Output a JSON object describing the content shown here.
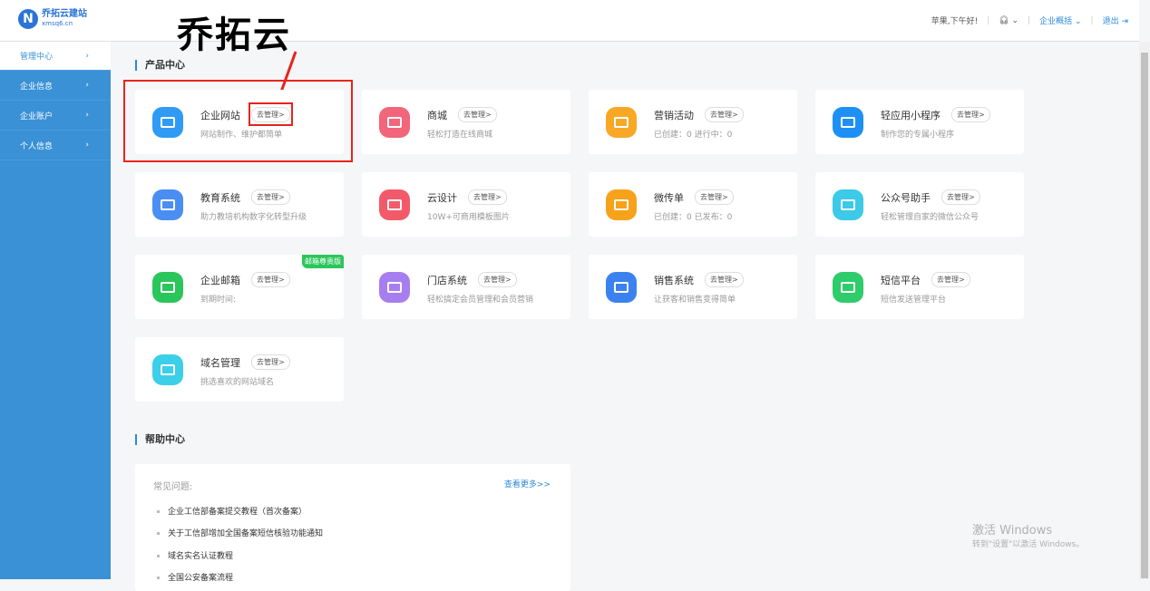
{
  "logo": {
    "name": "乔拓云建站",
    "url": "xmsq6.cn",
    "mark": "N"
  },
  "header": {
    "greeting": "苹果,下午好!",
    "enterprise": "企业概括",
    "logout": "退出"
  },
  "sidebar": {
    "items": [
      {
        "label": "管理中心"
      },
      {
        "label": "企业信息"
      },
      {
        "label": "企业账户"
      },
      {
        "label": "个人信息"
      }
    ]
  },
  "annotation": {
    "text": "乔拓云"
  },
  "products": {
    "title": "产品中心",
    "manage_label": "去管理>",
    "badge": "邮箱尊贵版",
    "cards": [
      {
        "name": "企业网站",
        "desc": "网站制作、维护都简单",
        "color": "#2f9bf5"
      },
      {
        "name": "商城",
        "desc": "轻松打造在线商城",
        "color": "#f2657a"
      },
      {
        "name": "营销活动",
        "desc": "已创建：0    进行中：0",
        "color": "#f9a825"
      },
      {
        "name": "轻应用小程序",
        "desc": "制作您的专属小程序",
        "color": "#1e90f5"
      },
      {
        "name": "教育系统",
        "desc": "助力教培机构数字化转型升级",
        "color": "#4a8ef2"
      },
      {
        "name": "云设计",
        "desc": "10W+可商用模板图片",
        "color": "#f25a6a"
      },
      {
        "name": "微传单",
        "desc": "已创建：0    已发布：0",
        "color": "#f7a21b"
      },
      {
        "name": "公众号助手",
        "desc": "轻松管理自家的微信公众号",
        "color": "#3dc9e8"
      },
      {
        "name": "企业邮箱",
        "desc": "到期时间:",
        "color": "#2bc65b"
      },
      {
        "name": "门店系统",
        "desc": "轻松搞定会员管理和会员营销",
        "color": "#a77ef0"
      },
      {
        "name": "销售系统",
        "desc": "让获客和销售变得简单",
        "color": "#3b82f0"
      },
      {
        "name": "短信平台",
        "desc": "短信发送管理平台",
        "color": "#2ecc6a"
      },
      {
        "name": "域名管理",
        "desc": "挑选喜欢的网站域名",
        "color": "#3ccfe8"
      }
    ]
  },
  "help": {
    "title": "帮助中心",
    "faq_title": "常见问题:",
    "more": "查看更多>>",
    "items": [
      "企业工信部备案提交教程（首次备案）",
      "关于工信部增加全国备案短信核验功能通知",
      "域名实名认证教程",
      "全国公安备案流程"
    ]
  },
  "watermark": {
    "line1": "激活 Windows",
    "line2": "转到\"设置\"以激活 Windows。"
  }
}
